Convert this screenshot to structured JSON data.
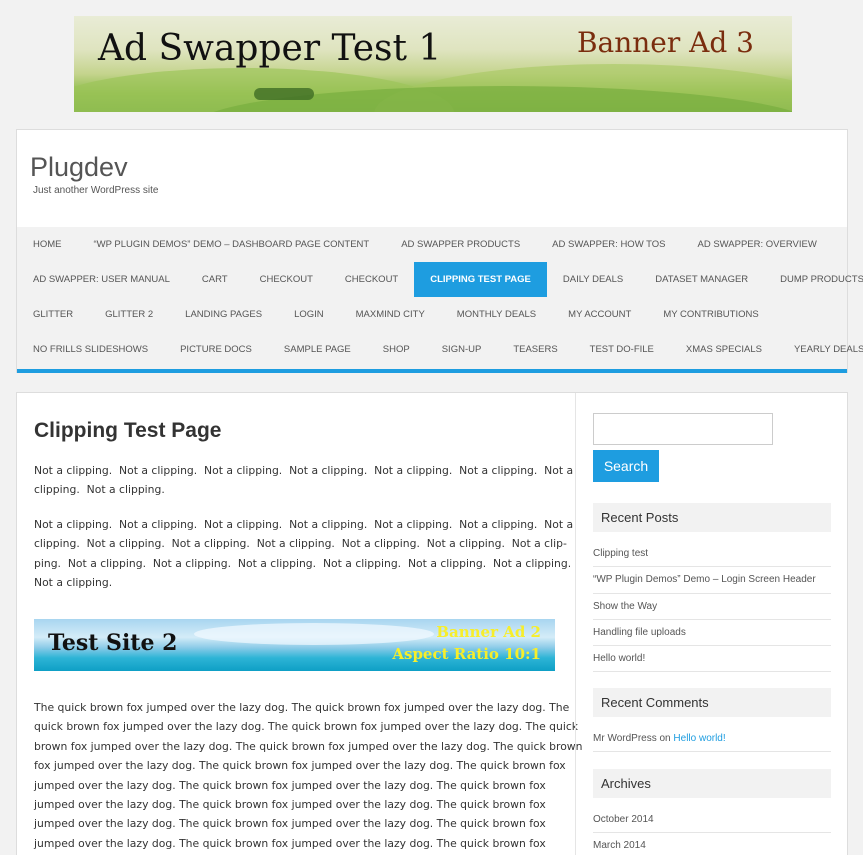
{
  "top_banner": {
    "title": "Ad Swapper Test 1",
    "tag": "Banner Ad 3"
  },
  "site": {
    "title": "Plugdev",
    "description": "Just another WordPress site"
  },
  "nav": {
    "rows": [
      [
        "HOME",
        "“WP PLUGIN DEMOS” DEMO – DASHBOARD PAGE CONTENT",
        "AD SWAPPER PRODUCTS",
        "AD SWAPPER: HOW TOS",
        "AD SWAPPER: OVERVIEW"
      ],
      [
        "AD SWAPPER: USER MANUAL",
        "CART",
        "CHECKOUT",
        "CHECKOUT",
        "CLIPPING TEST PAGE",
        "DAILY DEALS",
        "DATASET MANAGER",
        "DUMP PRODUCTS"
      ],
      [
        "GLITTER",
        "GLITTER 2",
        "LANDING PAGES",
        "LOGIN",
        "MAXMIND CITY",
        "MONTHLY DEALS",
        "MY ACCOUNT",
        "MY CONTRIBUTIONS"
      ],
      [
        "NO FRILLS SLIDESHOWS",
        "PICTURE DOCS",
        "SAMPLE PAGE",
        "SHOP",
        "SIGN-UP",
        "TEASERS",
        "TEST DO-FILE",
        "XMAS SPECIALS",
        "YEARLY DEALS"
      ]
    ],
    "active": "CLIPPING TEST PAGE"
  },
  "page": {
    "title": "Clipping Test Page",
    "para1_lines": [
      "Not a clipping.  Not a clipping.  Not a clipping.  Not a clipping.  Not a clipping.  Not a clipping.  Not a",
      "clipping.  Not a clipping."
    ],
    "para2_lines": [
      "Not a clipping.  Not a clipping.  Not a clipping.  Not a clipping.  Not a clipping.  Not a clipping.  Not a",
      "clipping.  Not a clipping.  Not a clipping.  Not a clipping.  Not a clipping.  Not a clipping.  Not a clip-",
      "ping.  Not a clipping.  Not a clipping.  Not a clipping.  Not a clipping.  Not a clipping.  Not a clipping.",
      "Not a clipping."
    ],
    "mid_banner": {
      "title": "Test Site 2",
      "tag1": "Banner Ad 2",
      "tag2": "Aspect Ratio 10:1"
    },
    "para3_lines": [
      "The quick brown fox jumped over the lazy dog. The quick brown fox jumped over the lazy dog. The",
      "quick brown fox jumped over the lazy dog. The quick brown fox jumped over the lazy dog. The quick",
      "brown fox jumped over the lazy dog. The quick brown fox jumped over the lazy dog. The quick brown",
      "fox jumped over the lazy dog. The quick brown fox jumped over the lazy dog. The quick brown fox",
      "jumped over the lazy dog. The quick brown fox jumped over the lazy dog. The quick brown fox",
      "jumped over the lazy dog. The quick brown fox jumped over the lazy dog. The quick brown fox",
      "jumped over the lazy dog. The quick brown fox jumped over the lazy dog. The quick brown fox",
      "jumped over the lazy dog. The quick brown fox jumped over the lazy dog. The quick brown fox"
    ]
  },
  "sidebar": {
    "search_placeholder": "",
    "search_button": "Search",
    "recent_posts_title": "Recent Posts",
    "recent_posts": [
      "Clipping test",
      "“WP Plugin Demos” Demo – Login Screen Header",
      "Show the Way",
      "Handling file uploads",
      "Hello world!"
    ],
    "recent_comments_title": "Recent Comments",
    "comment": {
      "author": "Mr WordPress",
      "on": "on",
      "post": "Hello world!"
    },
    "archives_title": "Archives",
    "archives": [
      "October 2014",
      "March 2014"
    ]
  }
}
